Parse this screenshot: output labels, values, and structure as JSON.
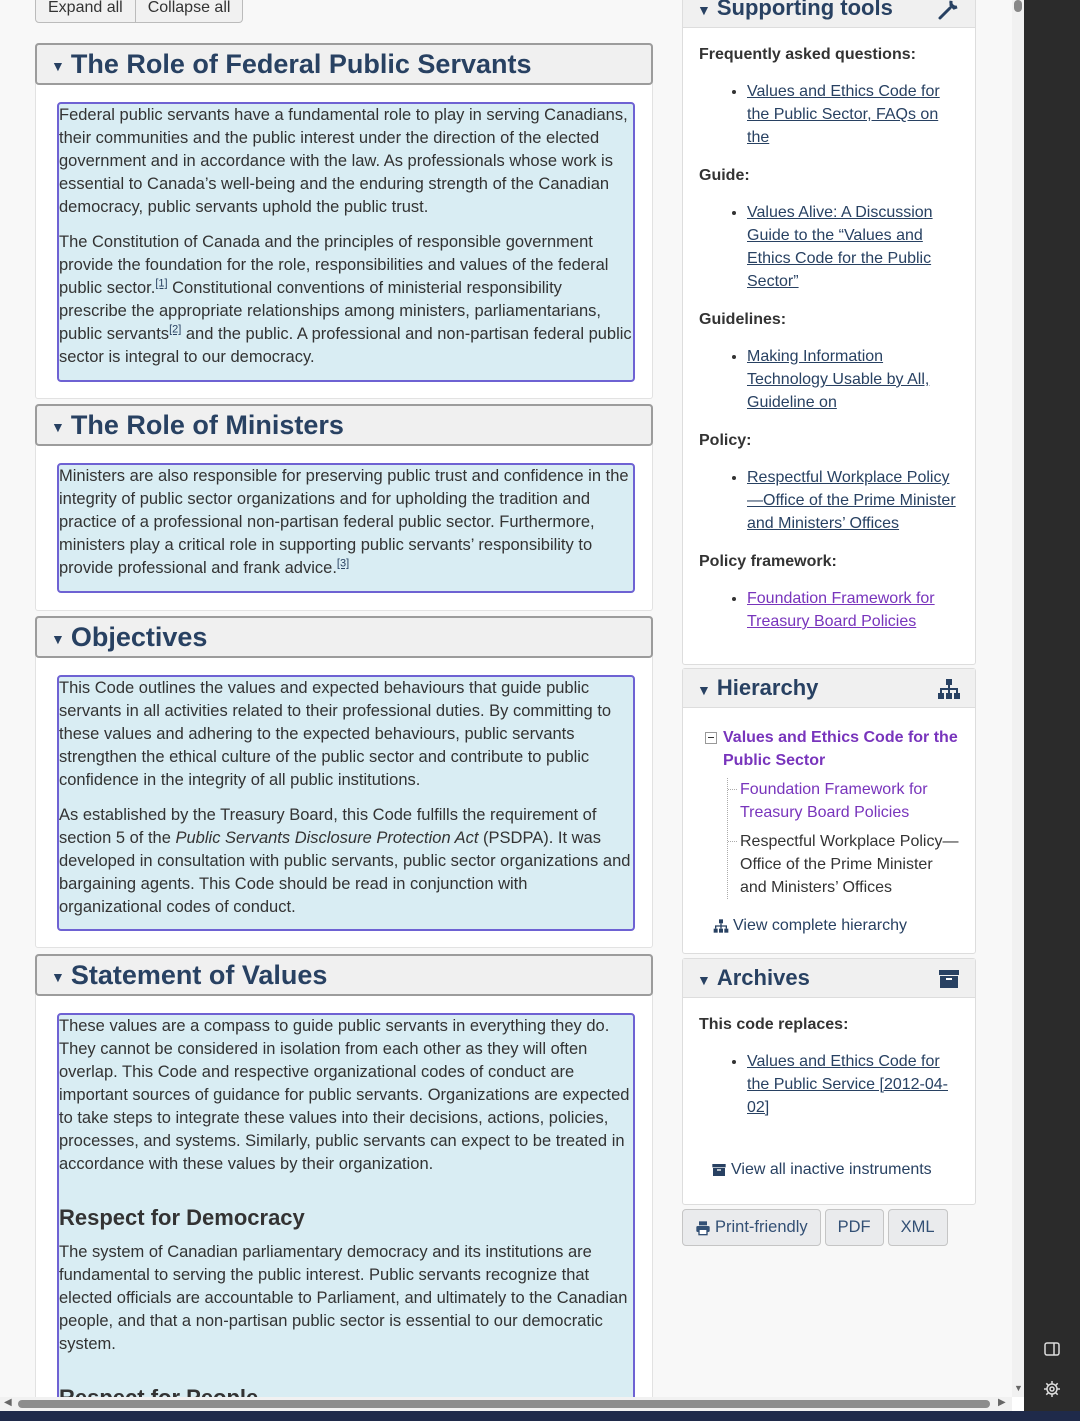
{
  "toolbar": {
    "expand_all": "Expand all",
    "collapse_all": "Collapse all"
  },
  "sections": [
    {
      "title": "The Role of Federal Public Servants",
      "paragraphs": [
        "Federal public servants have a fundamental role to play in serving Canadians, their communities and the public interest under the direction of the elected government and in accordance with the law. As professionals whose work is essential to Canada’s well-being and the enduring strength of the Canadian democracy, public servants uphold the public trust."
      ],
      "p2_part1": "The Constitution of Canada and the principles of responsible government provide the foundation for the role, responsibilities and values of the federal public sector.",
      "fn1": "[1]",
      "p2_part2": " Constitutional conventions of ministerial responsibility prescribe the appropriate relationships among ministers, parliamentarians, public servants",
      "fn2": "[2]",
      "p2_part3": " and the public. A professional and non-partisan federal public sector is integral to our democracy."
    },
    {
      "title": "The Role of Ministers",
      "p1": "Ministers are also responsible for preserving public trust and confidence in the integrity of public sector organizations and for upholding the tradition and practice of a professional non-partisan federal public sector. Furthermore, ministers play a critical role in supporting public servants’ responsibility to provide professional and frank advice.",
      "fn3": "[3]"
    },
    {
      "title": "Objectives",
      "p1": "This Code outlines the values and expected behaviours that guide public servants in all activities related to their professional duties. By committing to these values and adhering to the expected behaviours, public servants strengthen the ethical culture of the public sector and contribute to public confidence in the integrity of all public institutions.",
      "p2_part1": "As established by the Treasury Board, this Code fulfills the requirement of section 5 of the ",
      "p2_italic": "Public Servants Disclosure Protection Act",
      "p2_part2": " (PSDPA). It was developed in consultation with public servants, public sector organizations and bargaining agents. This Code should be read in conjunction with organizational codes of conduct."
    },
    {
      "title": "Statement of Values",
      "p1": "These values are a compass to guide public servants in everything they do. They cannot be considered in isolation from each other as they will often overlap. This Code and respective organizational codes of conduct are important sources of guidance for public servants. Organizations are expected to take steps to integrate these values into their decisions, actions, policies, processes, and systems. Similarly, public servants can expect to be treated in accordance with these values by their organization.",
      "h1": "Respect for Democracy",
      "h1_text": "The system of Canadian parliamentary democracy and its institutions are fundamental to serving the public interest. Public servants recognize that elected officials are accountable to Parliament, and ultimately to the Canadian people, and that a non-partisan public sector is essential to our democratic system.",
      "h2": "Respect for People"
    }
  ],
  "sidebar": {
    "supporting": {
      "title": "Supporting tools",
      "faq_label": "Frequently asked questions:",
      "faq_link": "Values and Ethics Code for the Public Sector, FAQs on the",
      "guide_label": "Guide:",
      "guide_link": "Values Alive: A Discussion Guide to the “Values and Ethics Code for the Public Sector”",
      "guidelines_label": "Guidelines:",
      "guidelines_link": "Making Information Technology Usable by All, Guideline on",
      "policy_label": "Policy:",
      "policy_link": "Respectful Workplace Policy—Office of the Prime Minister and Ministers’ Offices",
      "framework_label": "Policy framework:",
      "framework_link": "Foundation Framework for Treasury Board Policies"
    },
    "hierarchy": {
      "title": "Hierarchy",
      "root": "Values and Ethics Code for the Public Sector",
      "child1": "Foundation Framework for Treasury Board Policies",
      "child2": "Respectful Workplace Policy—Office of the Prime Minister and Ministers’ Offices",
      "view_all": "View complete hierarchy"
    },
    "archives": {
      "title": "Archives",
      "label": "This code replaces:",
      "link": "Values and Ethics Code for the Public Service [2012-04-02]",
      "view_all": "View all inactive instruments"
    },
    "buttons": {
      "print": "Print-friendly",
      "pdf": "PDF",
      "xml": "XML"
    }
  },
  "colors": {
    "heading": "#284162",
    "highlight_bg": "#d9edf3",
    "highlight_border": "#6e62d3",
    "visited": "#7834bc"
  },
  "icons": [
    "wrench-icon",
    "sitemap-icon",
    "archive-icon",
    "print-icon",
    "triangle-down-icon",
    "tree-minus-icon",
    "sidebar-toggle-icon",
    "settings-gear-icon"
  ]
}
